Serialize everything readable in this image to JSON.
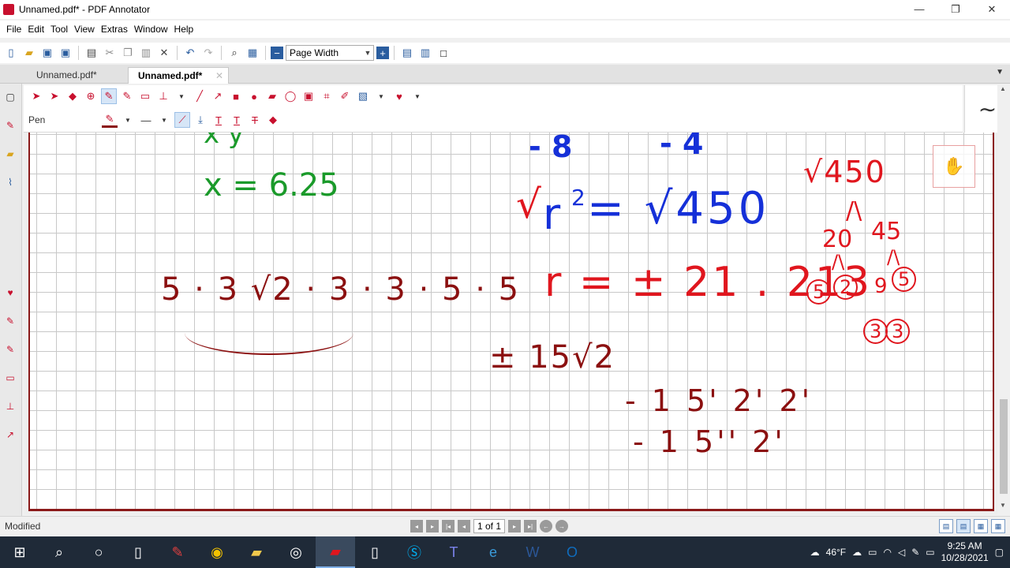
{
  "window": {
    "title": "Unnamed.pdf* - PDF Annotator",
    "minimize": "—",
    "maximize": "❐",
    "close": "✕"
  },
  "menu": [
    "File",
    "Edit",
    "Tool",
    "View",
    "Extras",
    "Window",
    "Help"
  ],
  "toolbar": {
    "zoom_value": "Page Width"
  },
  "tabs": {
    "inactive_label": "Unnamed.pdf*",
    "active_label": "Unnamed.pdf*"
  },
  "tool_panel": {
    "tool_name": "Pen"
  },
  "canvas": {
    "green_top": "x    y",
    "green_eq": "x = 6.25",
    "blue_top_left": "- 8",
    "blue_top_right": "- 4",
    "sqrt_red_left": "√",
    "r_squared": "r",
    "sup2": "2",
    "eq_450": "= √450",
    "r_value": "r = ± 21 . 213",
    "sqrt_expr": "5 · 3 √2 · 3 · 3 · 5 · 5",
    "pm_15root2": "± 15√2",
    "minus_line1": "- 1 5' 2' 2'",
    "minus_line2": "- 1 5'' 2'",
    "tree_root": "√450",
    "tree_20": "20",
    "tree_45": "45",
    "tree_5a": "5",
    "tree_2": "2",
    "tree_9": "9",
    "tree_5b": "5",
    "tree_3a": "3",
    "tree_3b": "3"
  },
  "status": {
    "text": "Modified",
    "page_of": "1 of 1"
  },
  "taskbar": {
    "weather": "46°F",
    "time": "9:25 AM",
    "date": "10/28/2021"
  }
}
